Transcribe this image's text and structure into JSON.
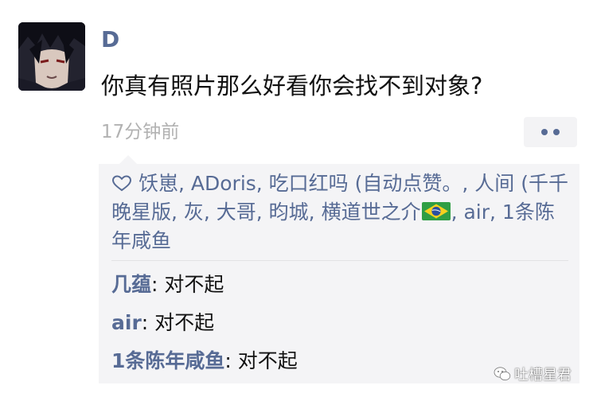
{
  "post": {
    "username": "D",
    "text": "你真有照片那么好看你会找不到对象?",
    "timestamp": "17分钟前"
  },
  "likes": {
    "icon": "heart-icon",
    "names_before_flag": "饫崽, ADoris, 吃口红吗 (自动点赞。, 人间 (千千晚星版, 灰, 大哥, 昀城, 横道世之介",
    "names_after_flag": ", air, 1条陈年咸鱼"
  },
  "comments": [
    {
      "author": "几蕴",
      "text": "对不起"
    },
    {
      "author": "air",
      "text": "对不起"
    },
    {
      "author": "1条陈年咸鱼",
      "text": "对不起"
    }
  ],
  "watermark": {
    "icon": "wechat-icon",
    "text": "吐槽星君"
  },
  "colors": {
    "link": "#576b95",
    "timestamp": "#b2b2b2",
    "panel": "#f4f4f6"
  }
}
